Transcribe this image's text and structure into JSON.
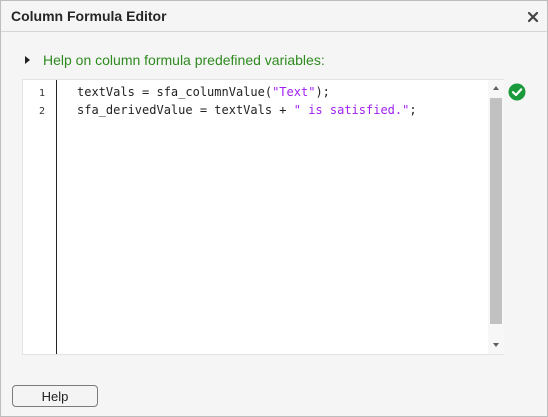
{
  "window": {
    "title": "Column Formula Editor",
    "close_icon": "close-icon"
  },
  "help": {
    "label": "Help on column formula predefined variables:",
    "expanded": false,
    "color": "#2e8b1f"
  },
  "editor": {
    "lines": [
      {
        "number": "1",
        "text_before": "textVals = sfa_columnValue(",
        "string": "\"Text\"",
        "text_after": ");"
      },
      {
        "number": "2",
        "text_before": "sfa_derivedValue = textVals + ",
        "string": "\" is satisfied.\"",
        "text_after": ";"
      }
    ],
    "string_color": "#a020f0",
    "status_icon": "check-circle-icon",
    "status_color": "#1a9a3a"
  },
  "footer": {
    "help_button": "Help"
  }
}
